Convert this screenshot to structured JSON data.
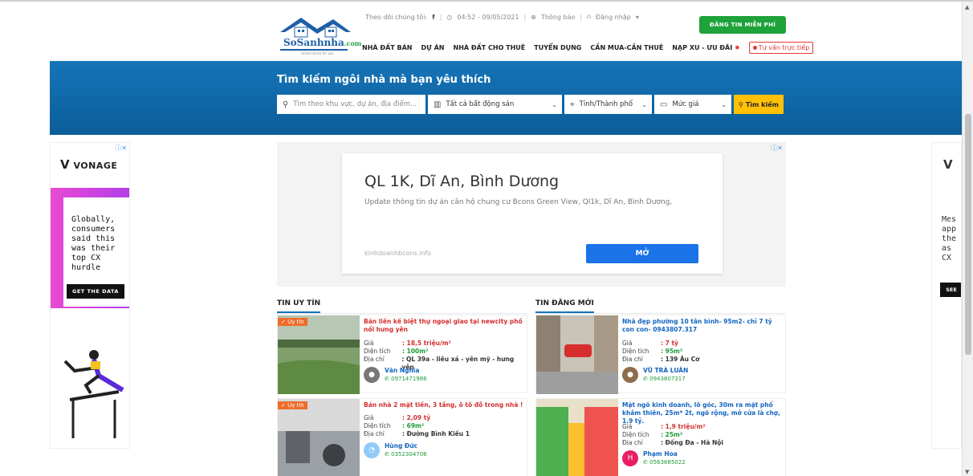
{
  "header": {
    "logo_text": "SoSanhnha",
    "logo_sub": ".com",
    "logo_tagline": "Great choice for you",
    "follow_label": "Theo dõi chúng tôi:",
    "facebook_icon": "f",
    "datetime": "04:52 - 09/05/2021",
    "notify_label": "Thông báo",
    "login_label": "Đăng nhập",
    "signup_button": "ĐĂNG TIN MIỄN PHÍ",
    "nav": [
      "NHÀ ĐẤT BÁN",
      "DỰ ÁN",
      "NHÀ ĐẤT CHO THUÊ",
      "TUYỂN DỤNG",
      "CẦN MUA-CẦN THUÊ",
      "NẠP XU - ƯU ĐÃI"
    ],
    "advisor_label": "Tư vấn trực tiếp"
  },
  "hero": {
    "title": "Tìm kiếm ngôi nhà mà bạn yêu thích",
    "search_placeholder": "Tìm theo khu vực, dự án, địa điểm...",
    "type_select": "Tất cả bất động sản",
    "city_select": "Tỉnh/Thành phố",
    "price_select": "Mức giá",
    "search_button": "Tìm kiếm"
  },
  "side_ad": {
    "brand": "VONAGE",
    "text_lines": [
      "Globally,",
      "consumers",
      "said this",
      "was their",
      "top CX",
      "hurdle"
    ],
    "cta": "GET THE DATA",
    "right_brand": "V",
    "right_text_lines": [
      "Mes",
      "app",
      "the",
      "as",
      "CX"
    ],
    "right_cta": "SEE"
  },
  "center_ad": {
    "heading": "QL 1K, Dĩ An, Bình Dương",
    "description": "Update thông tin dự án căn hộ chung cư Bcons Green View, Ql1k, Dĩ An, Bình Dương,",
    "source": "kinhdoanhbcons.info",
    "button": "MỞ"
  },
  "sections": {
    "left_title": "TIN UY TÍN",
    "right_title": "TIN ĐĂNG MỚI"
  },
  "labels": {
    "price": "Giá",
    "area": "Diện tích",
    "address": "Địa chỉ",
    "badge": "Uy tín"
  },
  "listings": [
    {
      "title": "Bán liền kề biệt thự ngoại giao tại newcity phố nối hưng yên",
      "price": ": 18,5 triệu/m²",
      "area": ": 100m²",
      "address": ": QL 39a - liêu xá - yên mỹ - hưng yên",
      "agent": "Văn Nghĩa",
      "phone": "0971471986"
    },
    {
      "title": "Bán nhà 2 mặt tiền, 3 tầng, ô tô đỗ trong nhà !",
      "price": ": 2,09 tỷ",
      "area": ": 69m²",
      "address": ": Đường Bình Kiều 1",
      "agent": "Hùng Đức",
      "phone": "0352304706"
    },
    {
      "title": "Nhà đẹp phường 10 tân bình- 95m2- chỉ 7 tỷ con con- 0943807.317",
      "price": ": 7 tỷ",
      "area": ": 95m²",
      "address": ": 139 Âu Cơ",
      "agent": "VŨ TRÀ LUÂN",
      "phone": "0943807317"
    },
    {
      "title": "Mặt ngõ kinh doanh, lô góc, 30m ra mặt phố khâm thiên, 25m* 2t, ngõ rộng, mở cửa là chợ, 1.9 tỷ.",
      "price": ": 1,9 triệu/m²",
      "area": ": 25m²",
      "address": ": Đống Đa - Hà Nội",
      "agent": "Phạm Hoa",
      "agent_initial": "H",
      "phone": "0563885022"
    }
  ]
}
